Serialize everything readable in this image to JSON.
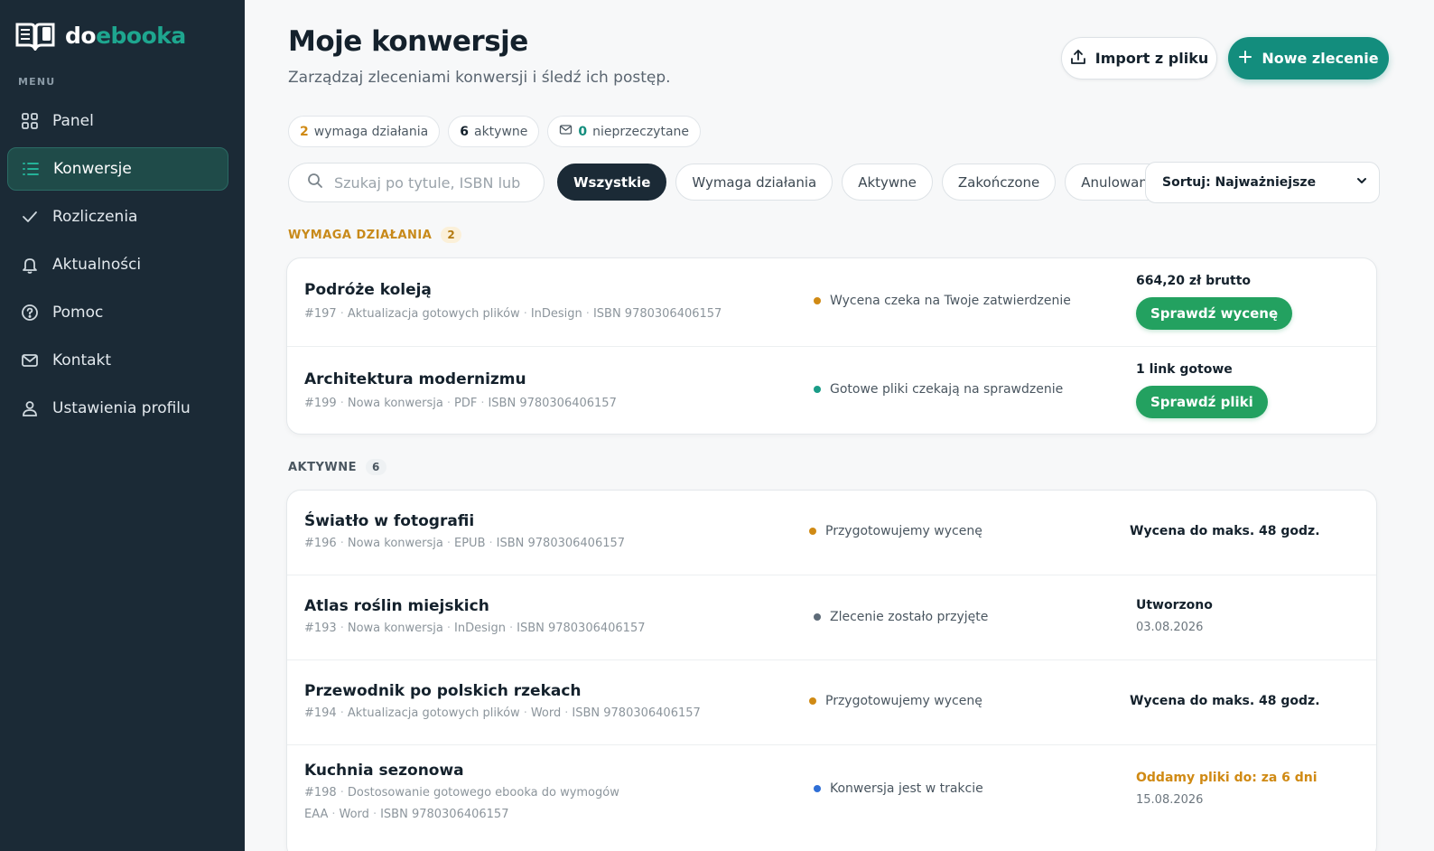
{
  "app": {
    "logo_part1": "do",
    "logo_part2": "ebooka",
    "brand_color": "#1ea68f"
  },
  "sidebar": {
    "menu_label": "MENU",
    "items": [
      {
        "label": "Panel",
        "icon": "grid-icon",
        "active": false
      },
      {
        "label": "Konwersje",
        "icon": "list-icon",
        "active": true
      },
      {
        "label": "Rozliczenia",
        "icon": "check-icon",
        "active": false
      },
      {
        "label": "Aktualności",
        "icon": "bell-icon",
        "active": false
      },
      {
        "label": "Pomoc",
        "icon": "help-circle-icon",
        "active": false
      },
      {
        "label": "Kontakt",
        "icon": "mail-icon",
        "active": false
      },
      {
        "label": "Ustawienia profilu",
        "icon": "user-icon",
        "active": false
      }
    ]
  },
  "header": {
    "title": "Moje konwersje",
    "subtitle": "Zarządzaj zleceniami konwersji i śledź ich postęp.",
    "import_label": "Import z pliku",
    "new_label": "Nowe zlecenie"
  },
  "summary": {
    "action_count": "2",
    "action_label": "wymaga działania",
    "active_count": "6",
    "active_label": "aktywne",
    "unread_count": "0",
    "unread_label": "nieprzeczytane"
  },
  "search": {
    "placeholder": "Szukaj po tytule, ISBN lub n",
    "value": ""
  },
  "filters": {
    "all": "Wszystkie",
    "action": "Wymaga działania",
    "active": "Aktywne",
    "done": "Zakończone",
    "cancelled": "Anulowane",
    "active_filter": "Wszystkie"
  },
  "sort": {
    "label": "Sortuj: Najważniejsze"
  },
  "sections": {
    "action": {
      "label": "WYMAGA DZIAŁANIA",
      "count": "2"
    },
    "active": {
      "label": "AKTYWNE",
      "count": "6"
    }
  },
  "action_orders": [
    {
      "title": "Podróże koleją",
      "id": "#197",
      "type": "Aktualizacja gotowych plików",
      "format": "InDesign",
      "isbn": "ISBN 9780306406157",
      "status": "Wycena czeka na Twoje zatwierdzenie",
      "status_color": "#d08a14",
      "right_label": "664,20 zł brutto",
      "button": "Sprawdź wycenę"
    },
    {
      "title": "Architektura modernizmu",
      "id": "#199",
      "type": "Nowa konwersja",
      "format": "PDF",
      "isbn": "ISBN 9780306406157",
      "status": "Gotowe pliki czekają na sprawdzenie",
      "status_color": "#1a9c87",
      "right_label": "1 link gotowe",
      "button": "Sprawdź pliki"
    }
  ],
  "active_orders": [
    {
      "title": "Światło w fotografii",
      "id": "#196",
      "type": "Nowa konwersja",
      "format": "EPUB",
      "isbn": "ISBN 9780306406157",
      "status": "Przygotowujemy wycenę",
      "status_color": "#d08a14",
      "right_label": "Wycena do maks. 48 godz.",
      "right_sub": ""
    },
    {
      "title": "Atlas roślin miejskich",
      "id": "#193",
      "type": "Nowa konwersja",
      "format": "InDesign",
      "isbn": "ISBN 9780306406157",
      "status": "Zlecenie zostało przyjęte",
      "status_color": "#5e6b78",
      "right_label": "Utworzono",
      "right_sub": "03.08.2026"
    },
    {
      "title": "Przewodnik po polskich rzekach",
      "id": "#194",
      "type": "Aktualizacja gotowych plików",
      "format": "Word",
      "isbn": "ISBN 9780306406157",
      "status": "Przygotowujemy wycenę",
      "status_color": "#d08a14",
      "right_label": "Wycena do maks. 48 godz.",
      "right_sub": ""
    },
    {
      "title": "Kuchnia sezonowa",
      "id": "#198",
      "type": "Dostosowanie gotowego ebooka do wymogów EAA",
      "format": "Word",
      "isbn": "ISBN 9780306406157",
      "status": "Konwersja jest w trakcie",
      "status_color": "#2f6fd6",
      "right_label": "Oddamy pliki do: za 6 dni",
      "right_label_color": "#d08a14",
      "right_sub": "15.08.2026"
    }
  ]
}
